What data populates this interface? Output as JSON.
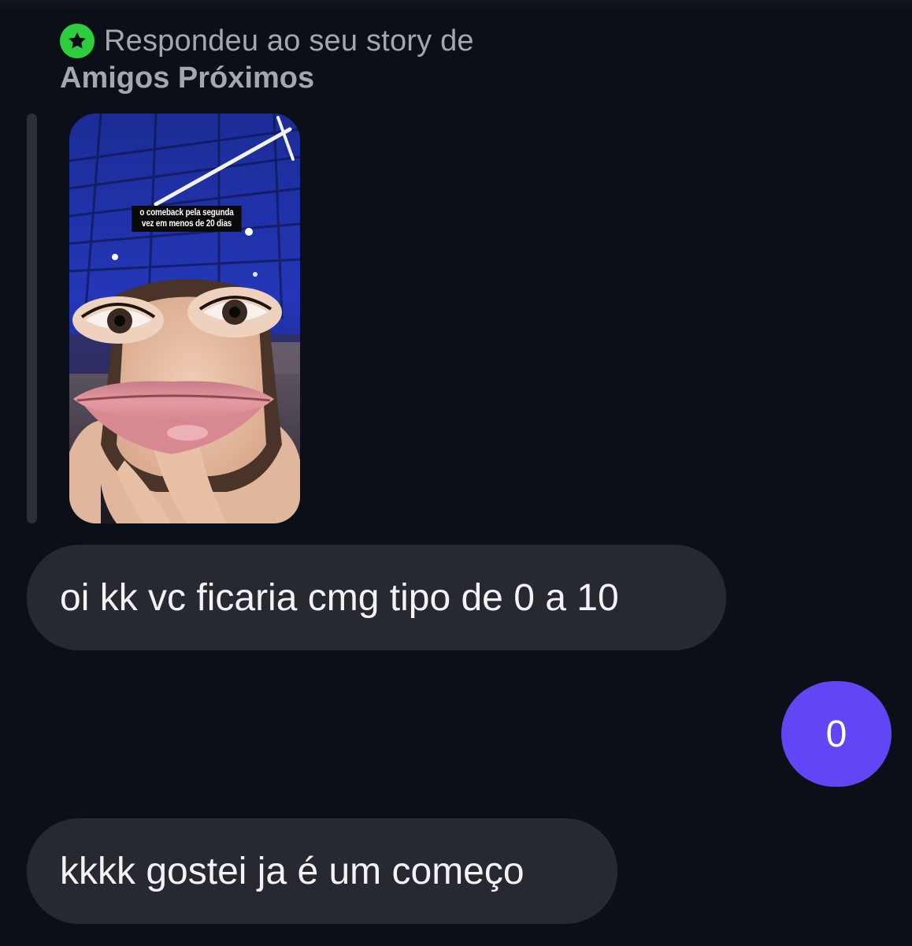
{
  "story_reply": {
    "prefix_text": "Respondeu ao seu story de",
    "audience_text": "Amigos Próximos",
    "badge_icon": "star-icon",
    "badge_color": "#2ecc3f",
    "story_caption": "o comeback pela segunda vez em menos de 20 dias"
  },
  "messages": [
    {
      "direction": "incoming",
      "text": "oi kk vc ficaria cmg tipo de 0 a 10"
    },
    {
      "direction": "outgoing",
      "text": "0"
    },
    {
      "direction": "incoming",
      "text": "kkkk gostei ja é um começo"
    }
  ],
  "colors": {
    "background": "#0b0f17",
    "incoming_bubble": "#262930",
    "outgoing_bubble": "#6146f5",
    "header_text": "#a3a7b0"
  }
}
